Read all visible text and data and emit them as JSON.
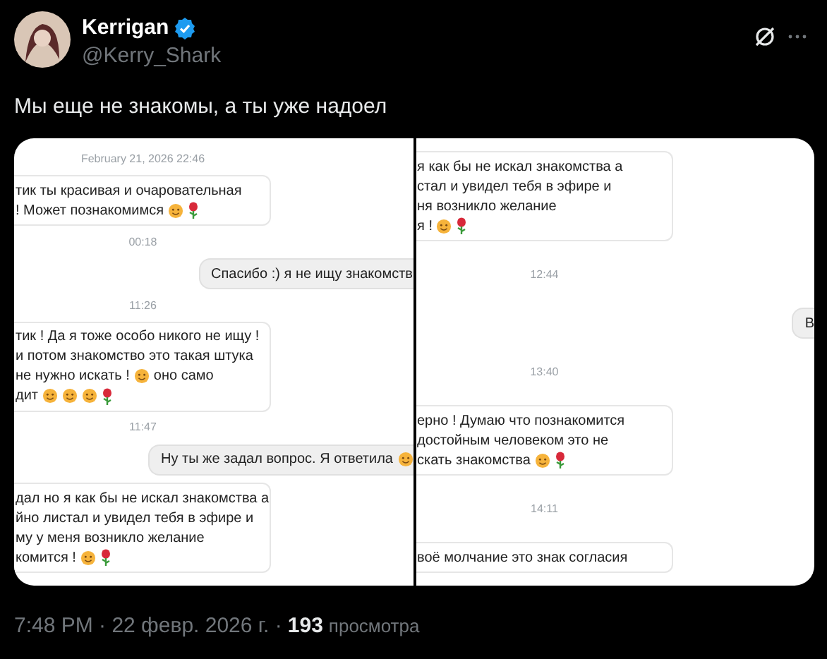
{
  "author": {
    "name": "Kerrigan",
    "handle": "@Kerry_Shark",
    "verified": true
  },
  "tweet": {
    "text": "Мы еще не знакомы, а ты уже надоел"
  },
  "screenshots": [
    {
      "items": [
        {
          "kind": "stamp",
          "text": "February 21, 2026 22:46"
        },
        {
          "kind": "incoming",
          "lines": [
            [
              {
                "kind": "text",
                "text": "тик ты красивая и очаровательная"
              }
            ],
            [
              {
                "kind": "text",
                "text": "! Может познакомимся"
              },
              {
                "kind": "emoji_face"
              },
              {
                "kind": "emoji_flower"
              }
            ]
          ]
        },
        {
          "kind": "stamp",
          "text": "00:18"
        },
        {
          "kind": "outgoing",
          "lines": [
            [
              {
                "kind": "text",
                "text": "Спасибо :) я не ищу знакомств"
              }
            ]
          ]
        },
        {
          "kind": "stamp",
          "text": "11:26"
        },
        {
          "kind": "incoming",
          "lines": [
            [
              {
                "kind": "text",
                "text": "тик ! Да я тоже особо никого не ищу !"
              }
            ],
            [
              {
                "kind": "text",
                "text": "и потом знакомство это такая штука"
              }
            ],
            [
              {
                "kind": "text",
                "text": "не нужно искать !"
              },
              {
                "kind": "emoji_face"
              },
              {
                "kind": "text",
                "text": "оно само"
              }
            ],
            [
              {
                "kind": "text",
                "text": "дит"
              },
              {
                "kind": "emoji_face"
              },
              {
                "kind": "emoji_face"
              },
              {
                "kind": "emoji_face"
              },
              {
                "kind": "emoji_flower"
              }
            ]
          ]
        },
        {
          "kind": "stamp",
          "text": "11:47"
        },
        {
          "kind": "outgoing",
          "lines": [
            [
              {
                "kind": "text",
                "text": "Ну ты же задал вопрос. Я ответила"
              },
              {
                "kind": "emoji_face"
              }
            ]
          ]
        },
        {
          "kind": "incoming",
          "lines": [
            [
              {
                "kind": "text",
                "text": "дал но я как бы не искал знакомства а"
              }
            ],
            [
              {
                "kind": "text",
                "text": "йно листал и увидел тебя в эфире и"
              }
            ],
            [
              {
                "kind": "text",
                "text": "му у меня возникло желание"
              }
            ],
            [
              {
                "kind": "text",
                "text": "комится !"
              },
              {
                "kind": "emoji_face"
              },
              {
                "kind": "emoji_flower"
              }
            ]
          ]
        }
      ]
    },
    {
      "items": [
        {
          "kind": "incoming",
          "lines": [
            [
              {
                "kind": "text",
                "text": "я как бы не искал знакомства а"
              }
            ],
            [
              {
                "kind": "text",
                "text": "стал и увидел тебя в эфире и"
              }
            ],
            [
              {
                "kind": "text",
                "text": "ня возникло желание"
              }
            ],
            [
              {
                "kind": "text",
                "text": "я !"
              },
              {
                "kind": "emoji_face"
              },
              {
                "kind": "emoji_flower"
              }
            ]
          ]
        },
        {
          "kind": "stamp",
          "text": "12:44"
        },
        {
          "kind": "outgoing",
          "lines": [
            [
              {
                "kind": "text",
                "text": "В"
              }
            ]
          ]
        },
        {
          "kind": "stamp",
          "text": "13:40"
        },
        {
          "kind": "incoming",
          "lines": [
            [
              {
                "kind": "text",
                "text": "ерно ! Думаю что познакомится"
              }
            ],
            [
              {
                "kind": "text",
                "text": "достойным человеком это не"
              }
            ],
            [
              {
                "kind": "text",
                "text": "скать знакомства"
              },
              {
                "kind": "emoji_face"
              },
              {
                "kind": "emoji_flower"
              }
            ]
          ]
        },
        {
          "kind": "stamp",
          "text": "14:11"
        },
        {
          "kind": "incoming",
          "lines": [
            [
              {
                "kind": "text",
                "text": "воё молчание это знак согласия"
              }
            ]
          ]
        }
      ]
    }
  ],
  "footer": {
    "time_date": "7:48 PM · 22 февр. 2026 г. ·",
    "views": "193",
    "views_label": "просмотра"
  }
}
